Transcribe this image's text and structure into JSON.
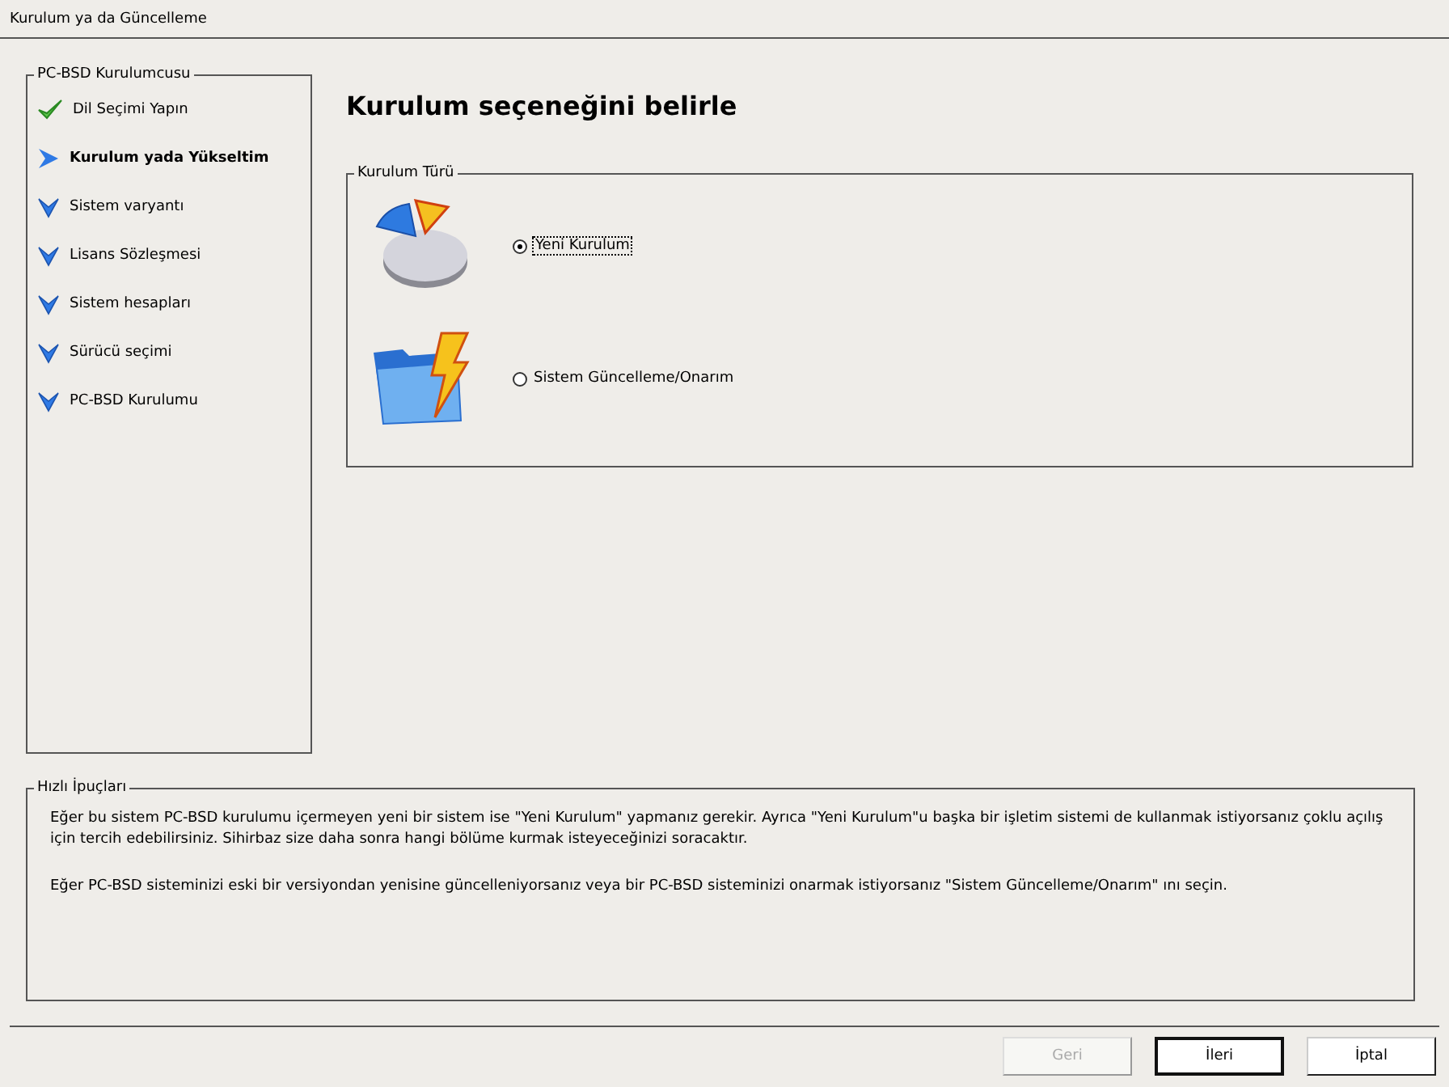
{
  "window": {
    "title": "Kurulum ya da Güncelleme"
  },
  "sidebar": {
    "title": "PC-BSD Kurulumcusu",
    "items": [
      {
        "label": "Dil Seçimi Yapın",
        "kind": "done"
      },
      {
        "label": "Kurulum yada Yükseltim",
        "kind": "current"
      },
      {
        "label": "Sistem varyantı",
        "kind": "pending"
      },
      {
        "label": "Lisans Sözleşmesi",
        "kind": "pending"
      },
      {
        "label": "Sistem hesapları",
        "kind": "pending"
      },
      {
        "label": "Sürücü seçimi",
        "kind": "pending"
      },
      {
        "label": "PC-BSD Kurulumu",
        "kind": "pending"
      }
    ]
  },
  "heading": "Kurulum seçeneğini belirle",
  "install_type": {
    "title": "Kurulum Türü",
    "options": [
      {
        "label": "Yeni Kurulum",
        "kind": "pie",
        "selected": true
      },
      {
        "label": "Sistem Güncelleme/Onarım",
        "kind": "folder",
        "selected": false
      }
    ]
  },
  "tips": {
    "title": "Hızlı İpuçları",
    "paragraphs": [
      "Eğer bu sistem PC-BSD kurulumu içermeyen yeni bir sistem ise \"Yeni Kurulum\" yapmanız gerekir. Ayrıca \"Yeni Kurulum\"u başka bir işletim sistemi de kullanmak istiyorsanız çoklu açılış için tercih edebilirsiniz. Sihirbaz size daha sonra hangi bölüme kurmak isteyeceğinizi soracaktır.",
      "Eğer PC-BSD sisteminizi eski bir versiyondan yenisine güncelleniyorsanız veya bir PC-BSD sisteminizi onarmak istiyorsanız  \"Sistem Güncelleme/Onarım\" ını seçin."
    ]
  },
  "buttons": [
    {
      "label": "Geri",
      "disabled": true
    },
    {
      "label": "İleri",
      "disabled": false
    },
    {
      "label": "İptal",
      "disabled": false
    }
  ]
}
